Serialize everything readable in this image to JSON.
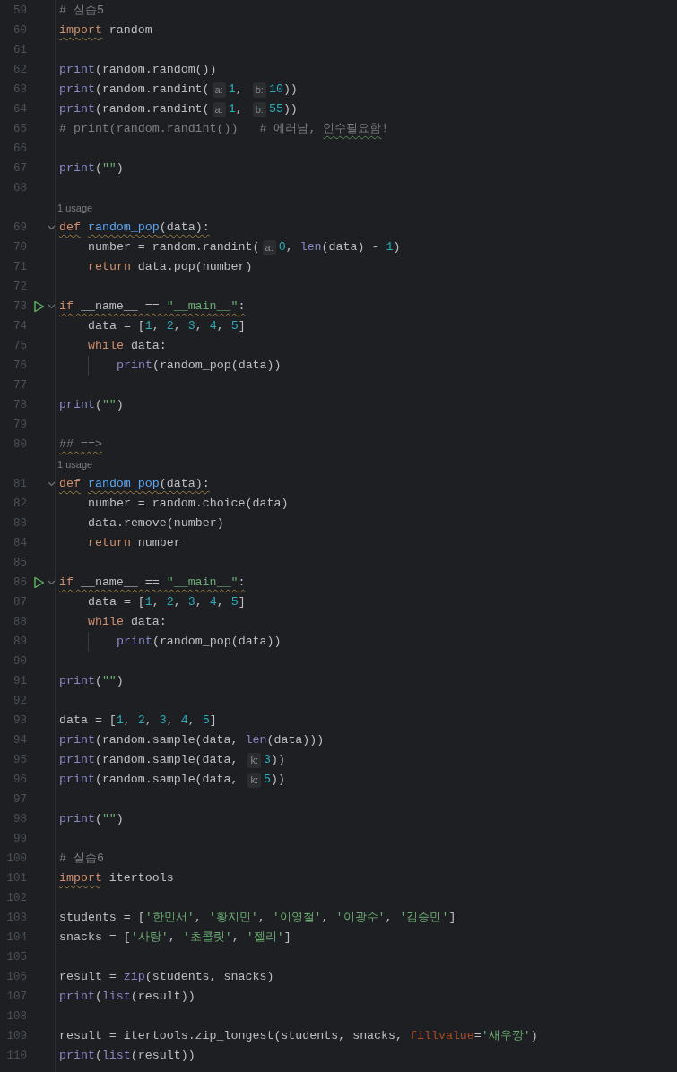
{
  "editor": {
    "lines": [
      {
        "kind": "code",
        "number": "59",
        "tokens": [
          {
            "kind": "comment",
            "text": "# 실습5"
          }
        ]
      },
      {
        "kind": "code",
        "number": "60",
        "tokens": [
          {
            "kind": "keyword",
            "text": "import",
            "warning": true
          },
          {
            "kind": "plain",
            "text": " random"
          }
        ]
      },
      {
        "kind": "code",
        "number": "61"
      },
      {
        "kind": "code",
        "number": "62",
        "tokens": [
          {
            "kind": "builtin",
            "text": "print"
          },
          {
            "kind": "plain",
            "text": "(random.random())"
          }
        ]
      },
      {
        "kind": "code",
        "number": "63",
        "tokens": [
          {
            "kind": "builtin",
            "text": "print"
          },
          {
            "kind": "plain",
            "text": "(random.randint("
          },
          {
            "kind": "hint",
            "text": "a:"
          },
          {
            "kind": "number",
            "text": "1"
          },
          {
            "kind": "plain",
            "text": ", "
          },
          {
            "kind": "hint",
            "text": "b:"
          },
          {
            "kind": "number",
            "text": "10"
          },
          {
            "kind": "plain",
            "text": "))"
          }
        ]
      },
      {
        "kind": "code",
        "number": "64",
        "tokens": [
          {
            "kind": "builtin",
            "text": "print"
          },
          {
            "kind": "plain",
            "text": "(random.randint("
          },
          {
            "kind": "hint",
            "text": "a:"
          },
          {
            "kind": "number",
            "text": "1"
          },
          {
            "kind": "plain",
            "text": ", "
          },
          {
            "kind": "hint",
            "text": "b:"
          },
          {
            "kind": "number",
            "text": "55"
          },
          {
            "kind": "plain",
            "text": "))"
          }
        ]
      },
      {
        "kind": "code",
        "number": "65",
        "tokens": [
          {
            "kind": "comment",
            "text": "# print(random.randint())   # 에러남, "
          },
          {
            "kind": "comment",
            "text": "인수필요함",
            "typo": true
          },
          {
            "kind": "comment",
            "text": "!"
          }
        ]
      },
      {
        "kind": "code",
        "number": "66"
      },
      {
        "kind": "code",
        "number": "67",
        "tokens": [
          {
            "kind": "builtin",
            "text": "print"
          },
          {
            "kind": "plain",
            "text": "("
          },
          {
            "kind": "string",
            "text": "\"\""
          },
          {
            "kind": "plain",
            "text": ")"
          }
        ]
      },
      {
        "kind": "code",
        "number": "68"
      },
      {
        "kind": "usage",
        "text": "1 usage"
      },
      {
        "kind": "code",
        "number": "69",
        "fold": true,
        "warning": true,
        "tokens": [
          {
            "kind": "keyword",
            "text": "def"
          },
          {
            "kind": "defname",
            "text": "random_pop"
          },
          {
            "kind": "plain",
            "text": "(data):"
          }
        ],
        "children": [
          {
            "kind": "code",
            "number": "70",
            "tokens": [
              {
                "kind": "plain",
                "text": "number = random.randint("
              },
              {
                "kind": "hint",
                "text": "a:"
              },
              {
                "kind": "number",
                "text": "0"
              },
              {
                "kind": "plain",
                "text": ", "
              },
              {
                "kind": "builtin",
                "text": "len"
              },
              {
                "kind": "plain",
                "text": "(data) - "
              },
              {
                "kind": "number",
                "text": "1"
              },
              {
                "kind": "plain",
                "text": ")"
              }
            ]
          },
          {
            "kind": "code",
            "number": "71",
            "tokens": [
              {
                "kind": "keyword",
                "text": "return"
              },
              {
                "kind": "plain",
                "text": " data.pop(number)"
              }
            ]
          }
        ]
      },
      {
        "kind": "code",
        "number": "72"
      },
      {
        "kind": "code",
        "number": "73",
        "run": true,
        "fold": true,
        "warning": true,
        "tokens": [
          {
            "kind": "keyword",
            "text": "if"
          },
          {
            "kind": "plain",
            "text": " __name__ == "
          },
          {
            "kind": "string",
            "text": "\"__main__\""
          },
          {
            "kind": "plain",
            "text": ":"
          }
        ],
        "children": [
          {
            "kind": "code",
            "number": "74",
            "tokens": [
              {
                "kind": "plain",
                "text": "data = ["
              },
              {
                "kind": "number",
                "text": "1"
              },
              {
                "kind": "plain",
                "text": ", "
              },
              {
                "kind": "number",
                "text": "2"
              },
              {
                "kind": "plain",
                "text": ", "
              },
              {
                "kind": "number",
                "text": "3"
              },
              {
                "kind": "plain",
                "text": ", "
              },
              {
                "kind": "number",
                "text": "4"
              },
              {
                "kind": "plain",
                "text": ", "
              },
              {
                "kind": "number",
                "text": "5"
              },
              {
                "kind": "plain",
                "text": "]"
              }
            ]
          },
          {
            "kind": "code",
            "number": "75",
            "tokens": [
              {
                "kind": "keyword",
                "text": "while"
              },
              {
                "kind": "plain",
                "text": " data:"
              }
            ],
            "children": [
              {
                "kind": "code",
                "number": "76",
                "tokens": [
                  {
                    "kind": "builtin",
                    "text": "print"
                  },
                  {
                    "kind": "plain",
                    "text": "(random_pop(data))"
                  }
                ]
              }
            ]
          }
        ]
      },
      {
        "kind": "code",
        "number": "77"
      },
      {
        "kind": "code",
        "number": "78",
        "tokens": [
          {
            "kind": "builtin",
            "text": "print"
          },
          {
            "kind": "plain",
            "text": "("
          },
          {
            "kind": "string",
            "text": "\"\""
          },
          {
            "kind": "plain",
            "text": ")"
          }
        ]
      },
      {
        "kind": "code",
        "number": "79"
      },
      {
        "kind": "code",
        "number": "80",
        "tokens": [
          {
            "kind": "comment",
            "text": "## ==>",
            "warning": true
          }
        ]
      },
      {
        "kind": "usage",
        "text": "1 usage"
      },
      {
        "kind": "code",
        "number": "81",
        "fold": true,
        "warning": true,
        "tokens": [
          {
            "kind": "keyword",
            "text": "def"
          },
          {
            "kind": "defname",
            "text": "random_pop"
          },
          {
            "kind": "plain",
            "text": "(data):"
          }
        ],
        "children": [
          {
            "kind": "code",
            "number": "82",
            "tokens": [
              {
                "kind": "plain",
                "text": "number = random.choice(data)"
              }
            ]
          },
          {
            "kind": "code",
            "number": "83",
            "tokens": [
              {
                "kind": "plain",
                "text": "data.remove(number)"
              }
            ]
          },
          {
            "kind": "code",
            "number": "84",
            "tokens": [
              {
                "kind": "keyword",
                "text": "return"
              },
              {
                "kind": "plain",
                "text": " number"
              }
            ]
          }
        ]
      },
      {
        "kind": "code",
        "number": "85"
      },
      {
        "kind": "code",
        "number": "86",
        "run": true,
        "fold": true,
        "warning": true,
        "tokens": [
          {
            "kind": "keyword",
            "text": "if"
          },
          {
            "kind": "plain",
            "text": " __name__ == "
          },
          {
            "kind": "string",
            "text": "\"__main__\""
          },
          {
            "kind": "plain",
            "text": ":"
          }
        ],
        "children": [
          {
            "kind": "code",
            "number": "87",
            "tokens": [
              {
                "kind": "plain",
                "text": "data = ["
              },
              {
                "kind": "number",
                "text": "1"
              },
              {
                "kind": "plain",
                "text": ", "
              },
              {
                "kind": "number",
                "text": "2"
              },
              {
                "kind": "plain",
                "text": ", "
              },
              {
                "kind": "number",
                "text": "3"
              },
              {
                "kind": "plain",
                "text": ", "
              },
              {
                "kind": "number",
                "text": "4"
              },
              {
                "kind": "plain",
                "text": ", "
              },
              {
                "kind": "number",
                "text": "5"
              },
              {
                "kind": "plain",
                "text": "]"
              }
            ]
          },
          {
            "kind": "code",
            "number": "88",
            "tokens": [
              {
                "kind": "keyword",
                "text": "while"
              },
              {
                "kind": "plain",
                "text": " data:"
              }
            ],
            "children": [
              {
                "kind": "code",
                "number": "89",
                "tokens": [
                  {
                    "kind": "builtin",
                    "text": "print"
                  },
                  {
                    "kind": "plain",
                    "text": "(random_pop(data))"
                  }
                ]
              }
            ]
          }
        ]
      },
      {
        "kind": "code",
        "number": "90"
      },
      {
        "kind": "code",
        "number": "91",
        "tokens": [
          {
            "kind": "builtin",
            "text": "print"
          },
          {
            "kind": "plain",
            "text": "("
          },
          {
            "kind": "string",
            "text": "\"\""
          },
          {
            "kind": "plain",
            "text": ")"
          }
        ]
      },
      {
        "kind": "code",
        "number": "92"
      },
      {
        "kind": "code",
        "number": "93",
        "tokens": [
          {
            "kind": "plain",
            "text": "data = ["
          },
          {
            "kind": "number",
            "text": "1"
          },
          {
            "kind": "plain",
            "text": ", "
          },
          {
            "kind": "number",
            "text": "2"
          },
          {
            "kind": "plain",
            "text": ", "
          },
          {
            "kind": "number",
            "text": "3"
          },
          {
            "kind": "plain",
            "text": ", "
          },
          {
            "kind": "number",
            "text": "4"
          },
          {
            "kind": "plain",
            "text": ", "
          },
          {
            "kind": "number",
            "text": "5"
          },
          {
            "kind": "plain",
            "text": "]"
          }
        ]
      },
      {
        "kind": "code",
        "number": "94",
        "tokens": [
          {
            "kind": "builtin",
            "text": "print"
          },
          {
            "kind": "plain",
            "text": "(random.sample(data, "
          },
          {
            "kind": "builtin",
            "text": "len"
          },
          {
            "kind": "plain",
            "text": "(data)))"
          }
        ]
      },
      {
        "kind": "code",
        "number": "95",
        "tokens": [
          {
            "kind": "builtin",
            "text": "print"
          },
          {
            "kind": "plain",
            "text": "(random.sample(data, "
          },
          {
            "kind": "hint",
            "text": "k:"
          },
          {
            "kind": "number",
            "text": "3"
          },
          {
            "kind": "plain",
            "text": "))"
          }
        ]
      },
      {
        "kind": "code",
        "number": "96",
        "tokens": [
          {
            "kind": "builtin",
            "text": "print"
          },
          {
            "kind": "plain",
            "text": "(random.sample(data, "
          },
          {
            "kind": "hint",
            "text": "k:"
          },
          {
            "kind": "number",
            "text": "5"
          },
          {
            "kind": "plain",
            "text": "))"
          }
        ]
      },
      {
        "kind": "code",
        "number": "97"
      },
      {
        "kind": "code",
        "number": "98",
        "tokens": [
          {
            "kind": "builtin",
            "text": "print"
          },
          {
            "kind": "plain",
            "text": "("
          },
          {
            "kind": "string",
            "text": "\"\""
          },
          {
            "kind": "plain",
            "text": ")"
          }
        ]
      },
      {
        "kind": "code",
        "number": "99"
      },
      {
        "kind": "code",
        "number": "100",
        "tokens": [
          {
            "kind": "comment",
            "text": "# 실습6"
          }
        ]
      },
      {
        "kind": "code",
        "number": "101",
        "tokens": [
          {
            "kind": "keyword",
            "text": "import",
            "warning": true
          },
          {
            "kind": "plain",
            "text": " itertools"
          }
        ]
      },
      {
        "kind": "code",
        "number": "102"
      },
      {
        "kind": "code",
        "number": "103",
        "tokens": [
          {
            "kind": "plain",
            "text": "students = ["
          },
          {
            "kind": "string",
            "text": "'한민서'"
          },
          {
            "kind": "plain",
            "text": ", "
          },
          {
            "kind": "string",
            "text": "'황지민'"
          },
          {
            "kind": "plain",
            "text": ", "
          },
          {
            "kind": "string",
            "text": "'이영철'"
          },
          {
            "kind": "plain",
            "text": ", "
          },
          {
            "kind": "string",
            "text": "'이광수'"
          },
          {
            "kind": "plain",
            "text": ", "
          },
          {
            "kind": "string",
            "text": "'김승민'"
          },
          {
            "kind": "plain",
            "text": "]"
          }
        ]
      },
      {
        "kind": "code",
        "number": "104",
        "tokens": [
          {
            "kind": "plain",
            "text": "snacks = ["
          },
          {
            "kind": "string",
            "text": "'사탕'"
          },
          {
            "kind": "plain",
            "text": ", "
          },
          {
            "kind": "string",
            "text": "'초콜릿'"
          },
          {
            "kind": "plain",
            "text": ", "
          },
          {
            "kind": "string",
            "text": "'젤리'"
          },
          {
            "kind": "plain",
            "text": "]"
          }
        ]
      },
      {
        "kind": "code",
        "number": "105"
      },
      {
        "kind": "code",
        "number": "106",
        "tokens": [
          {
            "kind": "plain",
            "text": "result = "
          },
          {
            "kind": "builtin",
            "text": "zip"
          },
          {
            "kind": "plain",
            "text": "(students, snacks)"
          }
        ]
      },
      {
        "kind": "code",
        "number": "107",
        "tokens": [
          {
            "kind": "builtin",
            "text": "print"
          },
          {
            "kind": "plain",
            "text": "("
          },
          {
            "kind": "builtin",
            "text": "list"
          },
          {
            "kind": "plain",
            "text": "(result))"
          }
        ]
      },
      {
        "kind": "code",
        "number": "108"
      },
      {
        "kind": "code",
        "number": "109",
        "tokens": [
          {
            "kind": "plain",
            "text": "result = itertools.zip_longest(students, snacks, "
          },
          {
            "kind": "param",
            "text": "fillvalue"
          },
          {
            "kind": "plain",
            "text": "="
          },
          {
            "kind": "string",
            "text": "'새우깡'"
          },
          {
            "kind": "plain",
            "text": ")"
          }
        ]
      },
      {
        "kind": "code",
        "number": "110",
        "tokens": [
          {
            "kind": "builtin",
            "text": "print"
          },
          {
            "kind": "plain",
            "text": "("
          },
          {
            "kind": "builtin",
            "text": "list"
          },
          {
            "kind": "plain",
            "text": "(result))"
          }
        ]
      }
    ]
  }
}
